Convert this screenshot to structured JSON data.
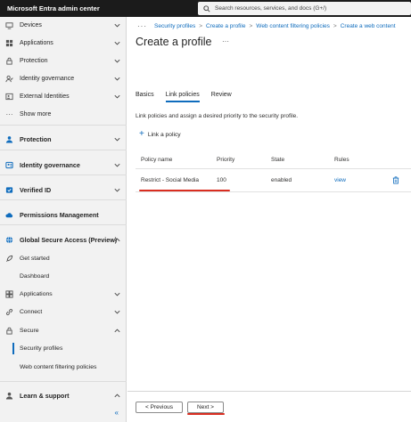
{
  "app": {
    "title": "Microsoft Entra admin center"
  },
  "search": {
    "placeholder": "Search resources, services, and docs (G+/)"
  },
  "sidebar": {
    "items": [
      {
        "label": "Devices"
      },
      {
        "label": "Applications"
      },
      {
        "label": "Protection"
      },
      {
        "label": "Identity governance"
      },
      {
        "label": "External Identities"
      },
      {
        "label": "Show more"
      },
      {
        "label": "Protection"
      },
      {
        "label": "Identity governance"
      },
      {
        "label": "Verified ID"
      },
      {
        "label": "Permissions Management"
      },
      {
        "label": "Global Secure Access (Preview)"
      },
      {
        "label": "Get started"
      },
      {
        "label": "Dashboard"
      },
      {
        "label": "Applications"
      },
      {
        "label": "Connect"
      },
      {
        "label": "Secure"
      },
      {
        "label": "Security profiles"
      },
      {
        "label": "Web content filtering policies"
      },
      {
        "label": "Learn & support"
      }
    ],
    "collapse_glyph": "«"
  },
  "breadcrumb": {
    "ellipsis": "···",
    "items": [
      "Security profiles",
      "Create a profile",
      "Web content filtering policies",
      "Create a web content"
    ],
    "separator": ">"
  },
  "page": {
    "title": "Create a profile",
    "more": "···"
  },
  "tabs": [
    {
      "label": "Basics",
      "active": false
    },
    {
      "label": "Link policies",
      "active": true
    },
    {
      "label": "Review",
      "active": false
    }
  ],
  "description": "Link policies and assign a desired priority to the security profile.",
  "link_policy_label": "Link a policy",
  "table": {
    "headers": [
      "Policy name",
      "Priority",
      "State",
      "Rules"
    ],
    "rows": [
      {
        "name": "Restrict - Social Media",
        "priority": "100",
        "state": "enabled",
        "rules": "view"
      }
    ]
  },
  "footer": {
    "previous": "< Previous",
    "next": "Next >"
  },
  "colors": {
    "accent": "#0f6cbd",
    "annotation": "#d92d20",
    "topbar": "#1b1b1b"
  }
}
